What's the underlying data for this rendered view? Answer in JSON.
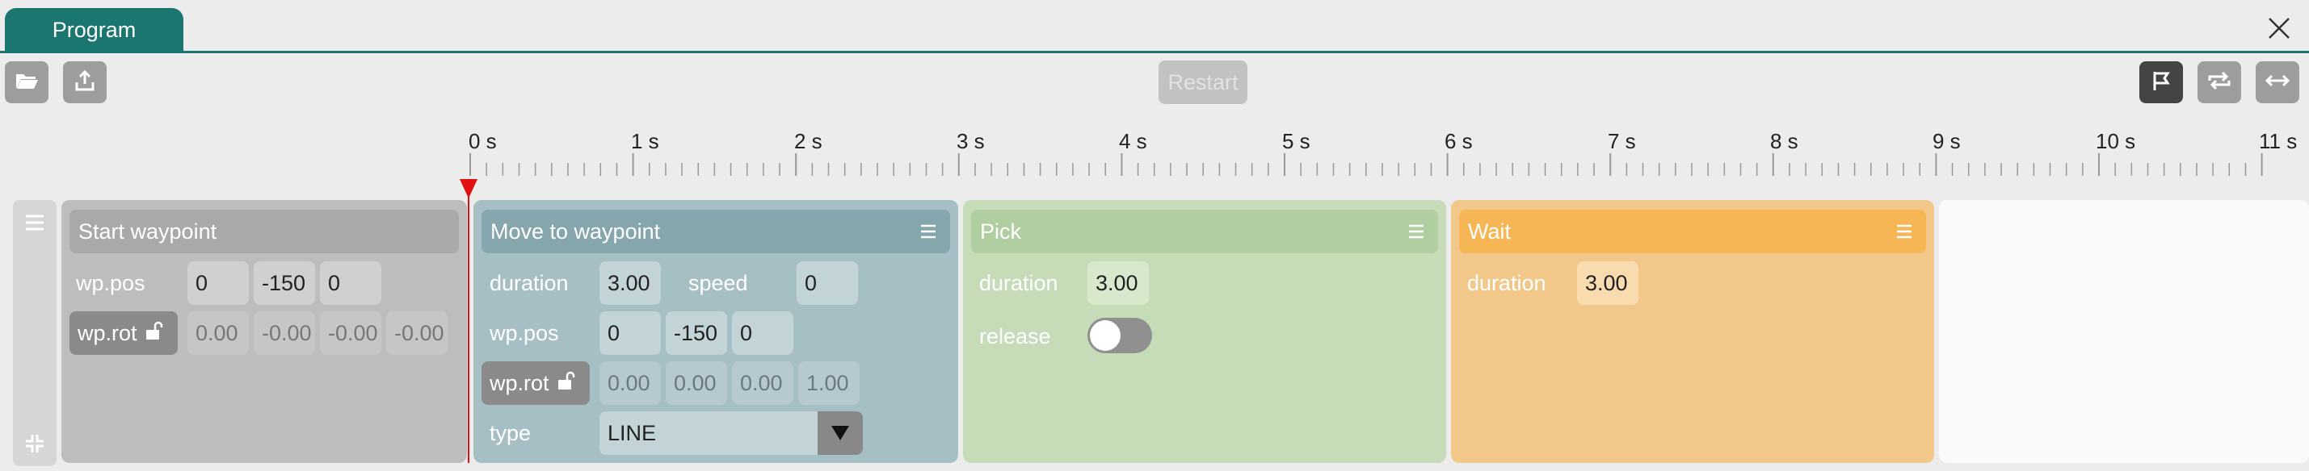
{
  "tab": {
    "label": "Program"
  },
  "toolbar": {
    "restart_label": "Restart"
  },
  "timeline": {
    "ticks": [
      "0 s",
      "1 s",
      "2 s",
      "3 s",
      "4 s",
      "5 s",
      "6 s",
      "7 s",
      "8 s",
      "9 s",
      "10 s",
      "11 s"
    ]
  },
  "colors": {
    "accent": "#1c7670",
    "playhead": "#e01010",
    "start": "#bdbdbd",
    "move": "#a6bfc5",
    "pick": "#c6dbb8",
    "wait": "#f2c88a"
  },
  "cards": {
    "start": {
      "title": "Start waypoint",
      "pos_label": "wp.pos",
      "pos": [
        "0",
        "-150",
        "0"
      ],
      "rot_label": "wp.rot",
      "rot": [
        "0.00",
        "-0.00",
        "-0.00",
        "-0.00"
      ]
    },
    "move": {
      "title": "Move to waypoint",
      "duration_label": "duration",
      "duration": "3.00",
      "speed_label": "speed",
      "speed": "0",
      "pos_label": "wp.pos",
      "pos": [
        "0",
        "-150",
        "0"
      ],
      "rot_label": "wp.rot",
      "rot": [
        "0.00",
        "0.00",
        "0.00",
        "1.00"
      ],
      "type_label": "type",
      "type_value": "LINE"
    },
    "pick": {
      "title": "Pick",
      "duration_label": "duration",
      "duration": "3.00",
      "release_label": "release",
      "release": false
    },
    "wait": {
      "title": "Wait",
      "duration_label": "duration",
      "duration": "3.00"
    }
  },
  "icons": [
    "folder-open-icon",
    "upload-icon",
    "close-icon",
    "flag-icon",
    "loop-icon",
    "horizontal-arrows-icon",
    "menu-icon",
    "unlock-icon",
    "collapse-icon",
    "triangle-down-icon"
  ]
}
